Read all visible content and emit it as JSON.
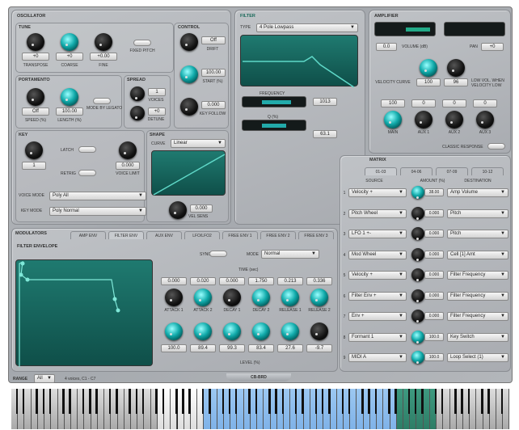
{
  "oscillator": {
    "title": "OSCILLATOR",
    "tune": {
      "title": "TUNE",
      "knobs": [
        {
          "label": "TRANSPOSE",
          "value": "+0"
        },
        {
          "label": "COARSE",
          "value": "+0"
        },
        {
          "label": "FINE",
          "value": "+0.00"
        }
      ],
      "fixed_pitch": "FIXED PITCH"
    },
    "portamento": {
      "title": "PORTAMENTO",
      "knobs": [
        {
          "label": "SPEED (%)",
          "value": "Off"
        },
        {
          "label": "LENGTH (%)",
          "value": "100.00"
        }
      ],
      "mode": "MODE BY LEGATO"
    },
    "unison": {
      "title": "SPREAD",
      "knobs": [
        {
          "label": "VOICES",
          "value": "1"
        },
        {
          "label": "DETUNE",
          "value": "+0"
        }
      ]
    },
    "coarse": {
      "title": "CONTROL",
      "knobs": [
        {
          "label": "DRIFT",
          "value": "Off"
        },
        {
          "label": "START (%)",
          "value": "100.00"
        },
        {
          "label": "KEY FOLLOW",
          "value": "0.000"
        }
      ]
    }
  },
  "voice": {
    "title": "KEY",
    "value": "1",
    "latch": "LATCH",
    "retrig": "RETRIG",
    "knob2_value": "0.000",
    "knob2_label": "VOICE LIMIT",
    "voice_mode_label": "VOICE MODE",
    "voice_mode": "Poly All",
    "key_mode_label": "KEY MODE",
    "key_mode": "Poly Normal"
  },
  "shape": {
    "title": "SHAPE",
    "curve_label": "CURVE",
    "curve": "Linear",
    "value": "0.000",
    "label": "VEL SENS"
  },
  "filter": {
    "title": "FILTER",
    "type_label": "TYPE",
    "type": "4 Pole Lowpass",
    "freq_label": "FREQUENCY",
    "freq": "1013",
    "q_label": "Q (%)",
    "q": "63.1"
  },
  "amplifier": {
    "title": "AMPLIFIER",
    "volume": "0.0",
    "volume_label": "VOLUME (dB)",
    "pan_label": "PAN",
    "pan": "+0",
    "velocity_label": "VELOCITY CURVE",
    "vel_value": "100",
    "vel2": "96",
    "low_vol_label": "LOW VOL. WHEN VELOCITY LOW",
    "outputs": [
      {
        "label": "MAIN",
        "value": "100"
      },
      {
        "label": "AUX 1",
        "value": "0"
      },
      {
        "label": "AUX 2",
        "value": "0"
      },
      {
        "label": "AUX 3",
        "value": "0"
      }
    ],
    "classic": "CLASSIC RESPONSE"
  },
  "matrix": {
    "title": "MATRIX",
    "tabs": [
      "01-03",
      "04-06",
      "07-09",
      "10-12"
    ],
    "headers": [
      "SOURCE",
      "AMOUNT (%)",
      "DESTINATION"
    ],
    "rows": [
      {
        "n": "1",
        "source": "Velocity +",
        "amount": "38.00",
        "dest": "Amp Volume"
      },
      {
        "n": "2",
        "source": "Pitch Wheel",
        "amount": "0.000",
        "dest": "Pitch"
      },
      {
        "n": "3",
        "source": "LFO 1 +-",
        "amount": "0.000",
        "dest": "Pitch"
      },
      {
        "n": "4",
        "source": "Mod Wheel",
        "amount": "0.000",
        "dest": "Cell [1] Amt"
      },
      {
        "n": "5",
        "source": "Velocity +",
        "amount": "0.000",
        "dest": "Filter Frequency"
      },
      {
        "n": "6",
        "source": "Filter Env +",
        "amount": "0.000",
        "dest": "Filter Frequency"
      },
      {
        "n": "7",
        "source": "Env +",
        "amount": "0.000",
        "dest": "Filter Frequency"
      },
      {
        "n": "8",
        "source": "Formant 1",
        "amount": "100.0",
        "dest": "Key Switch"
      },
      {
        "n": "9",
        "source": "MIDI A",
        "amount": "100.0",
        "dest": "Loop Select (1)"
      }
    ]
  },
  "modulators": {
    "title": "MODULATORS",
    "tabs": [
      "AMP ENV",
      "FILTER ENV",
      "AUX ENV",
      "LFO/LFO2",
      "FREE ENV 1",
      "FREE ENV 2",
      "FREE ENV 3"
    ],
    "active_tab": 1,
    "env_title": "FILTER ENVELOPE",
    "sync": "SYNC",
    "mode_label": "MODE",
    "mode": "Normal",
    "time_label": "TIME (sec)",
    "level_label": "LEVEL (%)",
    "stages": [
      {
        "label": "ATTACK 1",
        "time": "0.000",
        "level": "100.0"
      },
      {
        "label": "ATTACK 2",
        "time": "0.020",
        "level": "89.4"
      },
      {
        "label": "DECAY 1",
        "time": "0.000",
        "level": "99.3"
      },
      {
        "label": "DECAY 2",
        "time": "1.750",
        "level": "83.4"
      },
      {
        "label": "RELEASE 1",
        "time": "0.213",
        "level": "27.6"
      },
      {
        "label": "RELEASE 2",
        "time": "0.336",
        "level": "-9.7"
      }
    ]
  },
  "footer": {
    "range_label": "RANGE",
    "range": "All",
    "voices": "4 voices, C1 - C7",
    "center": "CB-BRD"
  },
  "colors": {
    "accent": "#1aa8a8",
    "screen": "#17665e",
    "keys_blue": "#7fb2e8",
    "keys_green": "#2d7d66"
  }
}
